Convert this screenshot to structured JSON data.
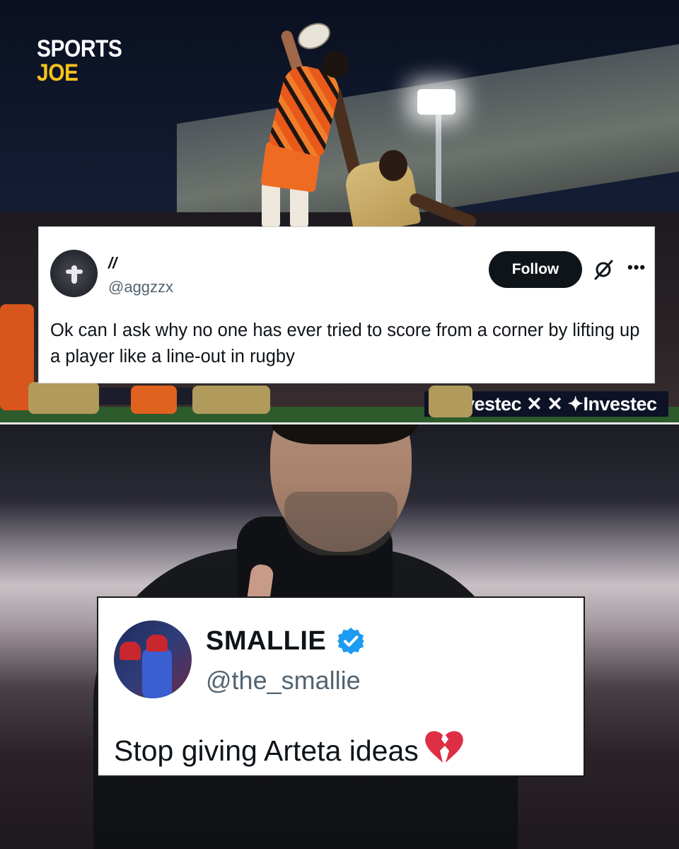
{
  "brand": {
    "line1": "SPORTS",
    "line2": "JOE",
    "accent_color": "#f7c21a"
  },
  "top_photo": {
    "ad_board_text": "vestec ✕ ✕ ✦Investec"
  },
  "tweet_1": {
    "display_name": "//",
    "handle": "@aggzzx",
    "follow_label": "Follow",
    "more_label": "•••",
    "text": "Ok can I ask why no one has ever tried to score from a corner by lifting up a player like a line-out in rugby",
    "icons": [
      "avatar",
      "grok-icon",
      "more-icon"
    ]
  },
  "tweet_2": {
    "display_name": "SMALLIE",
    "handle": "@the_smallie",
    "text": "Stop giving Arteta ideas",
    "verified": true,
    "verified_color": "#1d9bf0",
    "emoji_icon": "broken-heart-icon",
    "emoji_color": "#dd2e44"
  }
}
